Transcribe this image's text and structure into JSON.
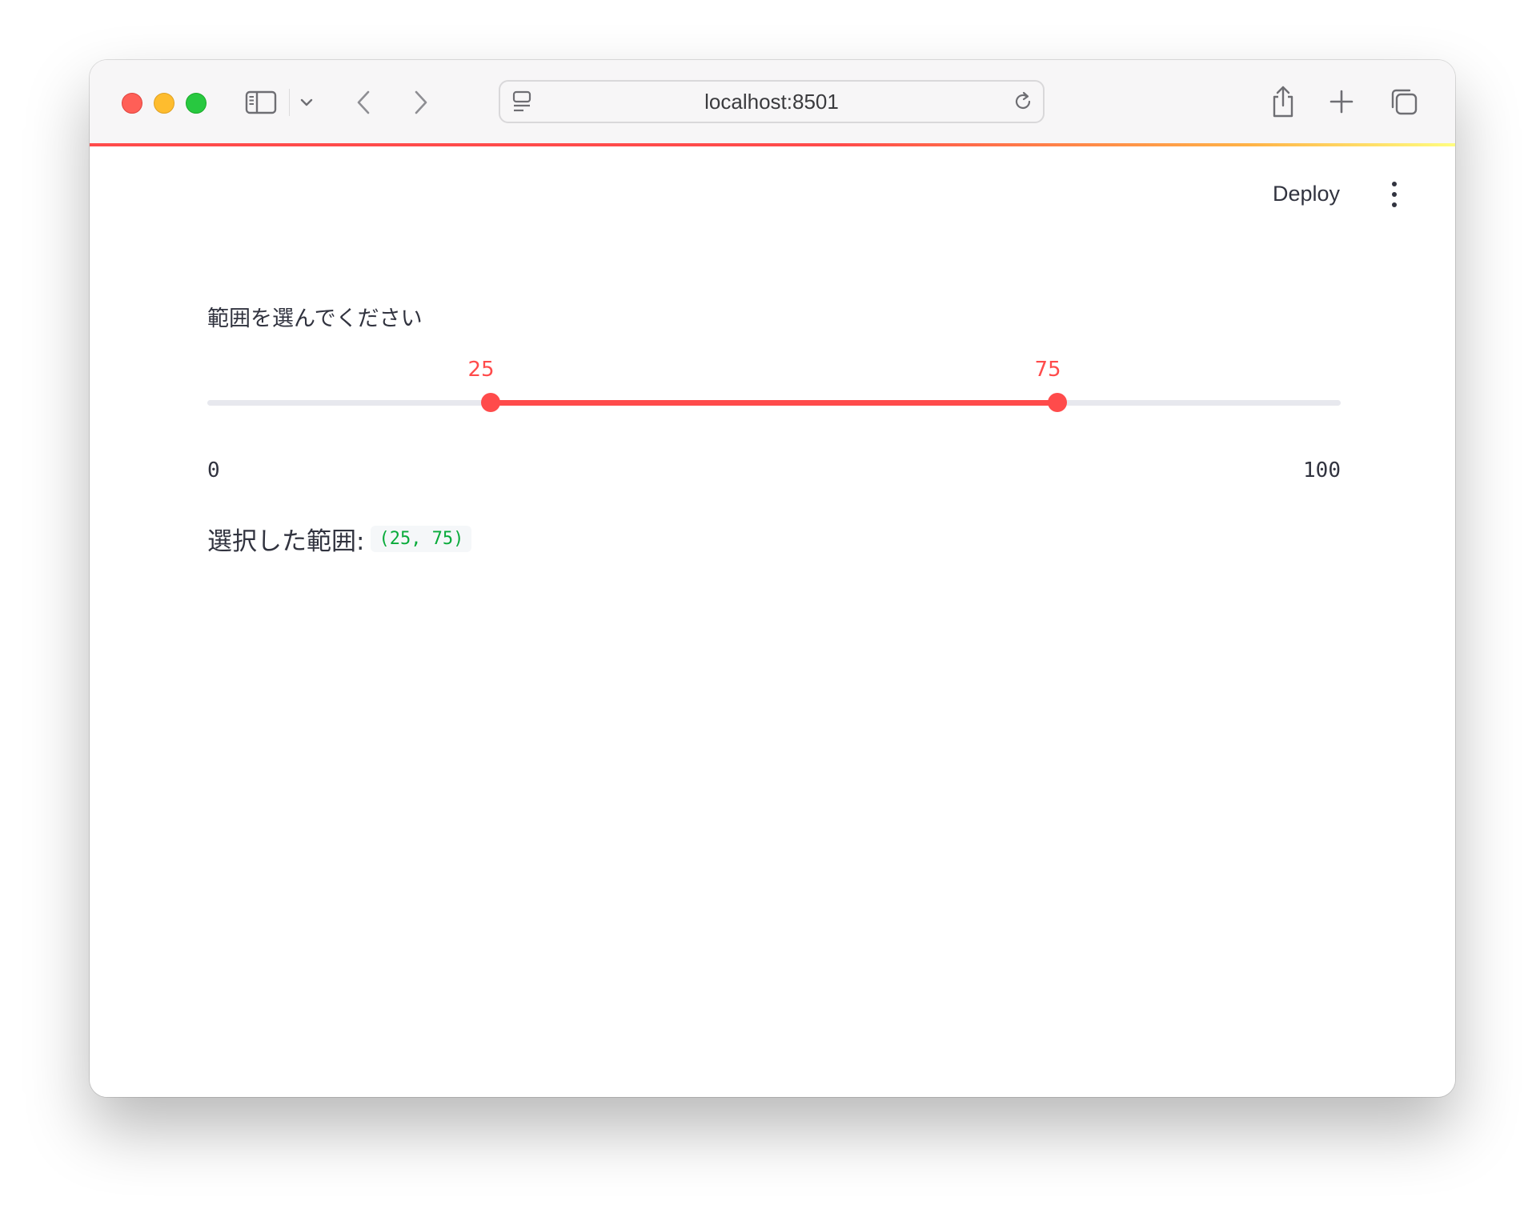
{
  "browser": {
    "url": "localhost:8501"
  },
  "header": {
    "deploy_label": "Deploy"
  },
  "slider": {
    "label": "範囲を選んでください",
    "min": 0,
    "max": 100,
    "min_label": "0",
    "max_label": "100",
    "low": 25,
    "high": 75,
    "low_label": "25",
    "high_label": "75",
    "accent_color": "#ff4b4b"
  },
  "result": {
    "label": "選択した範囲:",
    "value": "(25, 75)",
    "value_color": "#09ab3b"
  }
}
